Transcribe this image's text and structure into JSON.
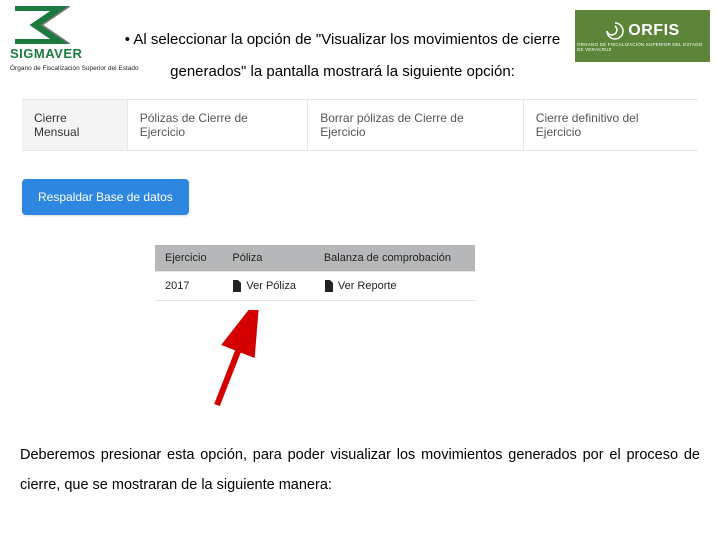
{
  "header": {
    "sigmaver": "SIGMAVER",
    "organo": "Órgano de Fiscalización Superior del Estado",
    "orfis": "ORFIS",
    "orfis_sub": "ÓRGANO DE FISCALIZACIÓN SUPERIOR DEL ESTADO DE VERACRUZ"
  },
  "instruction": {
    "bullet": "• Al seleccionar la opción de \"Visualizar los movimientos de cierre generados\" la pantalla mostrará la siguiente opción:"
  },
  "tabs": {
    "t0": "Cierre Mensual",
    "t1": "Pólizas de Cierre de Ejercicio",
    "t2": "Borrar pólizas de Cierre de Ejercicio",
    "t3": "Cierre definitivo del Ejercicio"
  },
  "backup_btn": "Respaldar Base de datos",
  "table": {
    "h0": "Ejercicio",
    "h1": "Póliza",
    "h2": "Balanza de comprobación",
    "year": "2017",
    "ver_poliza": "Ver  Póliza",
    "ver_reporte": "Ver  Reporte"
  },
  "footer": "Deberemos presionar esta opción, para poder visualizar los movimientos generados por el proceso de cierre, que se mostraran de la siguiente manera:"
}
